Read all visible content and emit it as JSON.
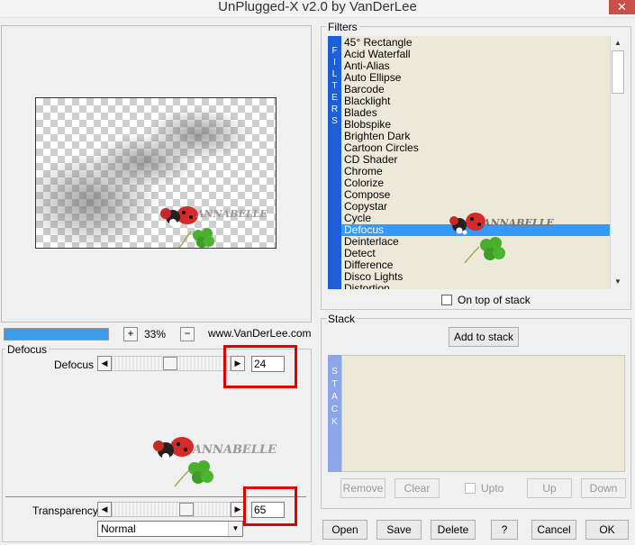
{
  "window": {
    "title": "UnPlugged-X v2.0 by VanDerLee",
    "close": "✕"
  },
  "preview": {
    "zoom_minus": "−",
    "zoom_plus": "+",
    "zoom_value": "33%",
    "site": "www.VanDerLee.com",
    "progress_fraction": 1.0
  },
  "watermark": {
    "text": "ANNABELLE"
  },
  "defocus_group": {
    "label": "Defocus",
    "param_label": "Defocus",
    "value": "24",
    "slider_fraction": 0.5
  },
  "transparency_group": {
    "param_label": "Transparency",
    "value": "65",
    "slider_fraction": 0.65,
    "blend_mode": "Normal"
  },
  "filters": {
    "label": "Filters",
    "strip_letters": [
      "F",
      "I",
      "L",
      "T",
      "E",
      "R",
      "S"
    ],
    "items": [
      "45° Rectangle",
      "Acid Waterfall",
      "Anti-Alias",
      "Auto Ellipse",
      "Barcode",
      "Blacklight",
      "Blades",
      "Blobspike",
      "Brighten Dark",
      "Cartoon Circles",
      "CD Shader",
      "Chrome",
      "Colorize",
      "Compose",
      "Copystar",
      "Cycle",
      "Defocus",
      "Deinterlace",
      "Detect",
      "Difference",
      "Disco Lights",
      "Distortion"
    ],
    "selected": "Defocus",
    "on_top_label": "On top of stack",
    "scroll_up": "▲",
    "scroll_down": "▼"
  },
  "stack": {
    "label": "Stack",
    "add_button": "Add to stack",
    "strip_letters": [
      "S",
      "T",
      "A",
      "C",
      "K"
    ],
    "remove": "Remove",
    "clear": "Clear",
    "upto": "Upto",
    "up": "Up",
    "down": "Down"
  },
  "footer": {
    "open": "Open",
    "save": "Save",
    "delete": "Delete",
    "help": "?",
    "cancel": "Cancel",
    "ok": "OK"
  },
  "colors": {
    "filter_strip": "#1c5fd6",
    "selection": "#3399ff",
    "list_bg": "#ede9d8",
    "highlight_box": "#e00000",
    "progress": "#3c9ae8"
  },
  "icons": {
    "left_arrow": "◀",
    "right_arrow": "▶",
    "dropdown": "▼"
  }
}
